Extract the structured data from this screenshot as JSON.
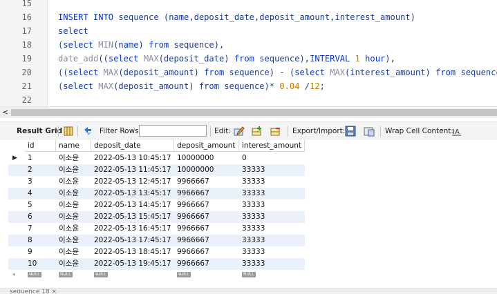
{
  "editor": {
    "lines": [
      {
        "num": "15",
        "code": []
      },
      {
        "num": "16",
        "code": [
          {
            "t": "INSERT INTO",
            "c": "kw"
          },
          {
            "t": " sequence (",
            "c": "plain"
          },
          {
            "t": "name",
            "c": "kw"
          },
          {
            "t": ",deposit_date,deposit_amount,interest_amount)",
            "c": "plain"
          }
        ]
      },
      {
        "num": "17",
        "code": [
          {
            "t": "select",
            "c": "kw"
          }
        ]
      },
      {
        "num": "18",
        "code": [
          {
            "t": "(",
            "c": "plain"
          },
          {
            "t": "select",
            "c": "kw"
          },
          {
            "t": " MIN",
            "c": "fn"
          },
          {
            "t": "(",
            "c": "plain"
          },
          {
            "t": "name",
            "c": "kw"
          },
          {
            "t": ") ",
            "c": "plain"
          },
          {
            "t": "from",
            "c": "kw"
          },
          {
            "t": " sequence),",
            "c": "plain"
          }
        ]
      },
      {
        "num": "19",
        "code": [
          {
            "t": "date_add",
            "c": "fn"
          },
          {
            "t": "((",
            "c": "plain"
          },
          {
            "t": "select",
            "c": "kw"
          },
          {
            "t": " MAX",
            "c": "fn"
          },
          {
            "t": "(deposit_date) ",
            "c": "plain"
          },
          {
            "t": "from",
            "c": "kw"
          },
          {
            "t": " sequence),",
            "c": "plain"
          },
          {
            "t": "INTERVAL",
            "c": "kw"
          },
          {
            "t": " ",
            "c": "plain"
          },
          {
            "t": "1",
            "c": "num"
          },
          {
            "t": " ",
            "c": "plain"
          },
          {
            "t": "hour",
            "c": "kw"
          },
          {
            "t": "),",
            "c": "plain"
          }
        ]
      },
      {
        "num": "20",
        "code": [
          {
            "t": "((",
            "c": "plain"
          },
          {
            "t": "select",
            "c": "kw"
          },
          {
            "t": " MAX",
            "c": "fn"
          },
          {
            "t": "(deposit_amount) ",
            "c": "plain"
          },
          {
            "t": "from",
            "c": "kw"
          },
          {
            "t": " sequence) - (",
            "c": "plain"
          },
          {
            "t": "select",
            "c": "kw"
          },
          {
            "t": " MAX",
            "c": "fn"
          },
          {
            "t": "(interest_amount) ",
            "c": "plain"
          },
          {
            "t": "from",
            "c": "kw"
          },
          {
            "t": " sequence)),",
            "c": "plain"
          }
        ]
      },
      {
        "num": "21",
        "code": [
          {
            "t": "(",
            "c": "plain"
          },
          {
            "t": "select",
            "c": "kw"
          },
          {
            "t": " MAX",
            "c": "fn"
          },
          {
            "t": "(deposit_amount) ",
            "c": "plain"
          },
          {
            "t": "from",
            "c": "kw"
          },
          {
            "t": " sequence)* ",
            "c": "plain"
          },
          {
            "t": "0.04",
            "c": "num"
          },
          {
            "t": " /",
            "c": "plain"
          },
          {
            "t": "12",
            "c": "num"
          },
          {
            "t": ";",
            "c": "plain"
          }
        ]
      },
      {
        "num": "22",
        "code": []
      }
    ]
  },
  "scrollbar": {
    "left_arrow": "<"
  },
  "toolbar": {
    "result_grid_label": "Result Grid",
    "filter_rows_label": "Filter Rows:",
    "filter_value": "",
    "edit_label": "Edit:",
    "export_import_label": "Export/Import:",
    "wrap_cell_label": "Wrap Cell Content:"
  },
  "grid": {
    "columns": [
      "id",
      "name",
      "deposit_date",
      "deposit_amount",
      "interest_amount"
    ],
    "rows": [
      [
        "1",
        "이소윤",
        "2022-05-13 10:45:17",
        "10000000",
        "0"
      ],
      [
        "2",
        "이소윤",
        "2022-05-13 11:45:17",
        "10000000",
        "33333"
      ],
      [
        "3",
        "이소윤",
        "2022-05-13 12:45:17",
        "9966667",
        "33333"
      ],
      [
        "4",
        "이소윤",
        "2022-05-13 13:45:17",
        "9966667",
        "33333"
      ],
      [
        "5",
        "이소윤",
        "2022-05-13 14:45:17",
        "9966667",
        "33333"
      ],
      [
        "6",
        "이소윤",
        "2022-05-13 15:45:17",
        "9966667",
        "33333"
      ],
      [
        "7",
        "이소윤",
        "2022-05-13 16:45:17",
        "9966667",
        "33333"
      ],
      [
        "8",
        "이소윤",
        "2022-05-13 17:45:17",
        "9966667",
        "33333"
      ],
      [
        "9",
        "이소윤",
        "2022-05-13 18:45:17",
        "9966667",
        "33333"
      ],
      [
        "10",
        "이소윤",
        "2022-05-13 19:45:17",
        "9966667",
        "33333"
      ]
    ],
    "null_label": "NULL",
    "current_row_marker": "▶",
    "new_row_marker": "*"
  },
  "bottom_tab": "sequence 18 ×"
}
